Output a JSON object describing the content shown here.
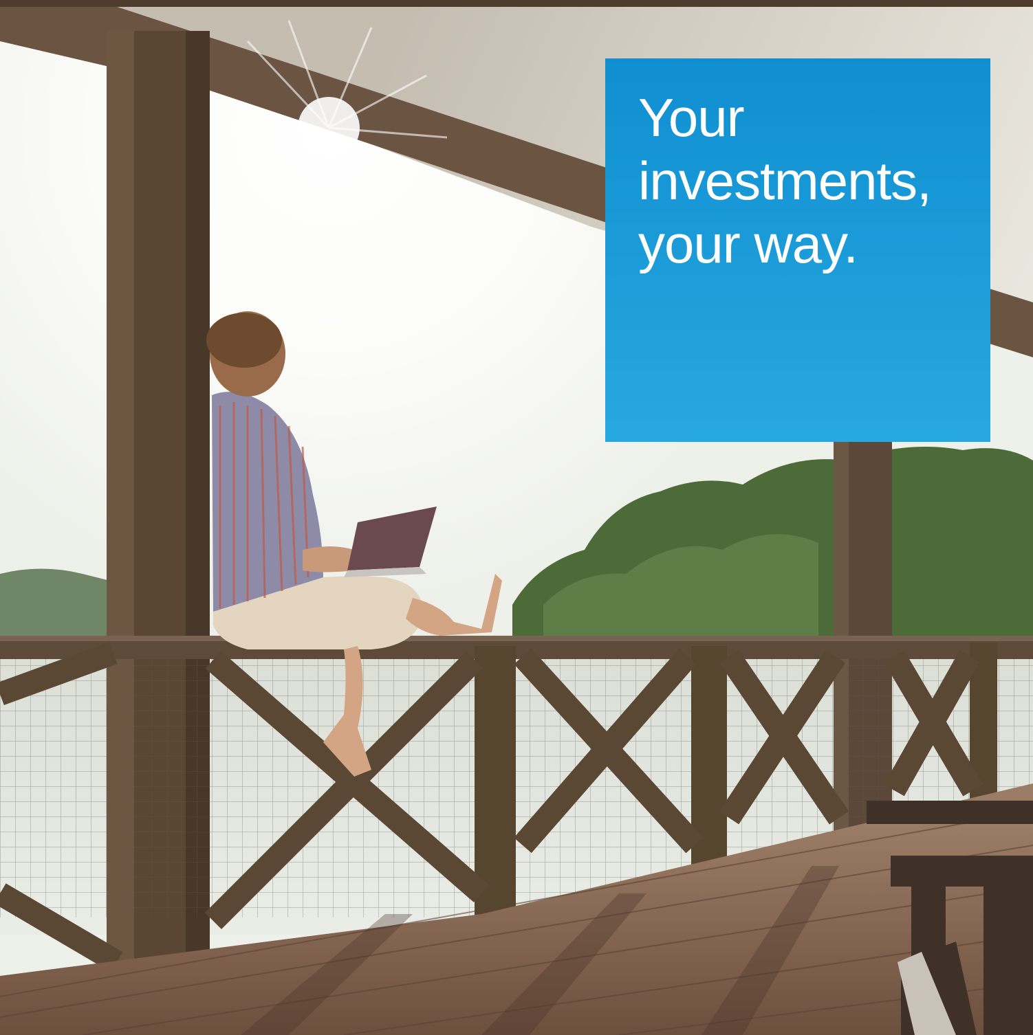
{
  "headline": {
    "lines": [
      "Your",
      "investments,",
      "your way."
    ]
  },
  "colors": {
    "headline_box_top": "#0f8fd0",
    "headline_box_bottom": "#27a8e0",
    "headline_text": "#ffffff",
    "sky": "#fdfdfb",
    "wood": "#5a4632",
    "deck": "#8b6a55",
    "water": "#cfd7cf",
    "trees": "#4f6e3a"
  },
  "photo": {
    "scene": "man-with-laptop-on-lakeside-porch-railing"
  }
}
